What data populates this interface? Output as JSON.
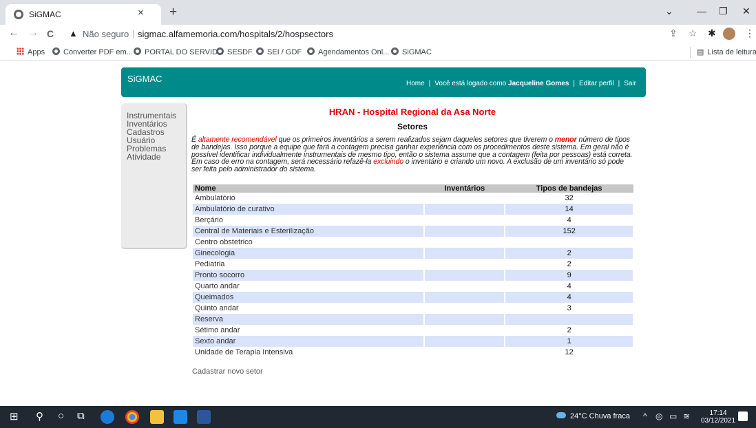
{
  "browser": {
    "tab_title": "SiGMAC",
    "tab_close": "×",
    "new_tab": "+",
    "window_controls": {
      "chevron": "⌄",
      "minimize": "—",
      "restore": "❐",
      "close": "✕"
    },
    "nav": {
      "back": "←",
      "forward": "→",
      "reload": "C"
    },
    "security_label": "Não seguro",
    "url": "sigmac.alfamemoria.com/hospitals/2/hospsectors",
    "bookmarks": [
      "Apps",
      "Converter PDF em...",
      "PORTAL DO SERVID...",
      "SESDF",
      "SEI / GDF",
      "Agendamentos Onl...",
      "SiGMAC"
    ],
    "reading_list": "Lista de leitura"
  },
  "app": {
    "logo": "SiGMAC",
    "nav": {
      "home": "Home",
      "logged_prefix": "Você está logado como",
      "user_name": "Jacqueline Gomes",
      "edit_profile": "Editar perfil",
      "logout": "Sair"
    },
    "sidebar": [
      "Instrumentais",
      "Inventários",
      "Cadastros",
      "Usuário",
      "Problemas",
      "Atividade"
    ],
    "page_title": "HRAN - Hospital Regional da Asa Norte",
    "page_subtitle": "Setores",
    "notice": {
      "p1": "É ",
      "hl1": "altamente recomendável",
      "p2": " que os primeiros inventários a serem realizados sejam daqueles setores que tiverem o ",
      "strong": "menor",
      "p3": " número de tipos de bandejas. Isso porque a equipe que fará a contagem precisa ganhar experiência com os procedimentos deste sistema. Em geral não é possível identificar individualmente instrumentais de mesmo tipo, então o sistema assume que a contagem (feita por pessoas) está correta. Em caso de erro na contagem, será necessário refazê-la ",
      "hl2": "excluindo",
      "p4": " o inventário e criando um novo. A exclusão de um inventário só pode ser feita pelo administrador do sistema."
    },
    "table": {
      "headers": [
        "Nome",
        "Inventários",
        "Tipos de bandejas"
      ],
      "rows": [
        {
          "name": "Ambulatório",
          "inv": "",
          "tipos": "32"
        },
        {
          "name": "Ambulatório de curativo",
          "inv": "",
          "tipos": "14"
        },
        {
          "name": "Berçário",
          "inv": "",
          "tipos": "4"
        },
        {
          "name": "Central de Materiais e Esterilização",
          "inv": "",
          "tipos": "152"
        },
        {
          "name": "Centro obstetrico",
          "inv": "",
          "tipos": ""
        },
        {
          "name": "Ginecologia",
          "inv": "",
          "tipos": "2"
        },
        {
          "name": "Pediatria",
          "inv": "",
          "tipos": "2"
        },
        {
          "name": "Pronto socorro",
          "inv": "",
          "tipos": "9"
        },
        {
          "name": "Quarto andar",
          "inv": "",
          "tipos": "4"
        },
        {
          "name": "Queimados",
          "inv": "",
          "tipos": "4"
        },
        {
          "name": "Quinto andar",
          "inv": "",
          "tipos": "3"
        },
        {
          "name": "Reserva",
          "inv": "",
          "tipos": ""
        },
        {
          "name": "Sétimo andar",
          "inv": "",
          "tipos": "2"
        },
        {
          "name": "Sexto andar",
          "inv": "",
          "tipos": "1"
        },
        {
          "name": "Unidade de Terapia Intensiva",
          "inv": "",
          "tipos": "12"
        }
      ]
    },
    "new_sector_link": "Cadastrar novo setor"
  },
  "taskbar": {
    "weather": "24°C  Chuva fraca",
    "time": "17:14",
    "date": "03/12/2021",
    "notification_count": "4"
  },
  "colors": {
    "header_bg": "#008b8b",
    "title_red": "#e20000",
    "row_alt": "#d9e3fa",
    "table_head": "#c6c6c6",
    "taskbar": "#202832"
  }
}
